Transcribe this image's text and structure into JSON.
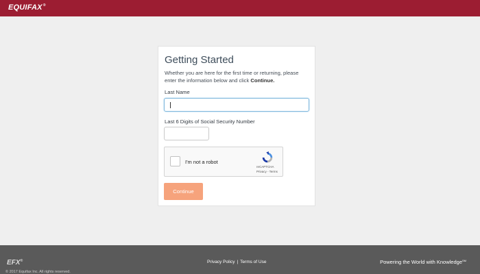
{
  "header": {
    "logo_text": "EQUIFAX",
    "logo_mark": "®"
  },
  "form": {
    "title": "Getting Started",
    "intro": "Whether you are here for the first time or returning, please enter the information below and click",
    "intro_action": "Continue.",
    "last_name_label": "Last Name",
    "last_name_value": "",
    "ssn_label": "Last 6 Digits of Social Security Number",
    "ssn_value": "",
    "captcha": {
      "label": "I'm not a robot",
      "brand": "reCAPTCHA",
      "links": "Privacy - Terms",
      "checked": false
    },
    "continue_label": "Continue"
  },
  "footer": {
    "logo_text": "EFX",
    "logo_mark": "®",
    "copyright": "© 2017 Equifax Inc. All rights reserved.",
    "privacy_label": "Privacy Policy",
    "separator": "|",
    "terms_label": "Terms of Use",
    "tagline": "Powering the World with Knowledge",
    "tagline_mark": "SM"
  },
  "colors": {
    "header_bg": "#9c1d32",
    "footer_bg": "#5a5a5a",
    "page_bg": "#efefef",
    "continue_bg": "#f6a37c",
    "focus_border": "#7fb8dc"
  }
}
